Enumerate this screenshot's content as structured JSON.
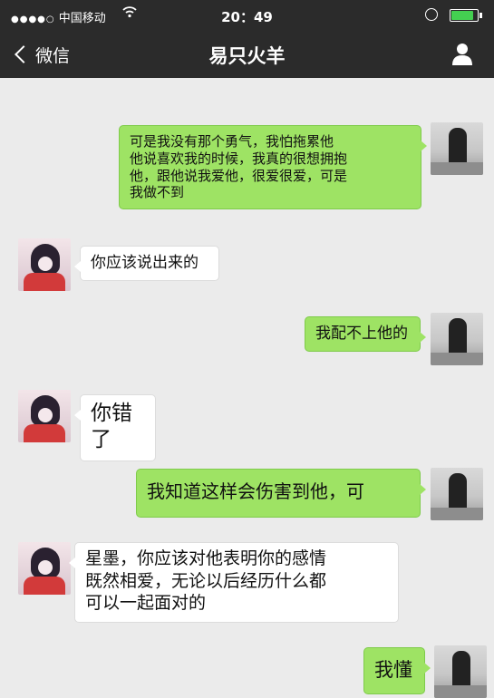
{
  "status_bar": {
    "signal": "●●●●○",
    "carrier": "中国移动",
    "time": "20：49"
  },
  "nav": {
    "back_label": "微信",
    "title": "易只火羊"
  },
  "colors": {
    "bar": "#2b2b2b",
    "background": "#ebebeb",
    "sent_bubble": "#9ee364",
    "received_bubble": "#ffffff"
  },
  "messages": [
    {
      "side": "right",
      "lines": [
        "可是我没有那个勇气，我怕拖累他",
        "他说喜欢我的时候，我真的很想拥抱",
        "他，跟他说我爱他，很爱很爱，可是",
        "我做不到"
      ]
    },
    {
      "side": "left",
      "lines": [
        "你应该说出来的"
      ]
    },
    {
      "side": "right",
      "lines": [
        "我配不上他的"
      ]
    },
    {
      "side": "left",
      "lines": [
        "你错了"
      ]
    },
    {
      "side": "right",
      "lines": [
        "我知道这样会伤害到他，可"
      ]
    },
    {
      "side": "left",
      "lines": [
        "星墨，你应该对他表明你的感情",
        "既然相爱，无论以后经历什么都",
        "可以一起面对的"
      ]
    },
    {
      "side": "right",
      "lines": [
        "我懂"
      ]
    }
  ]
}
